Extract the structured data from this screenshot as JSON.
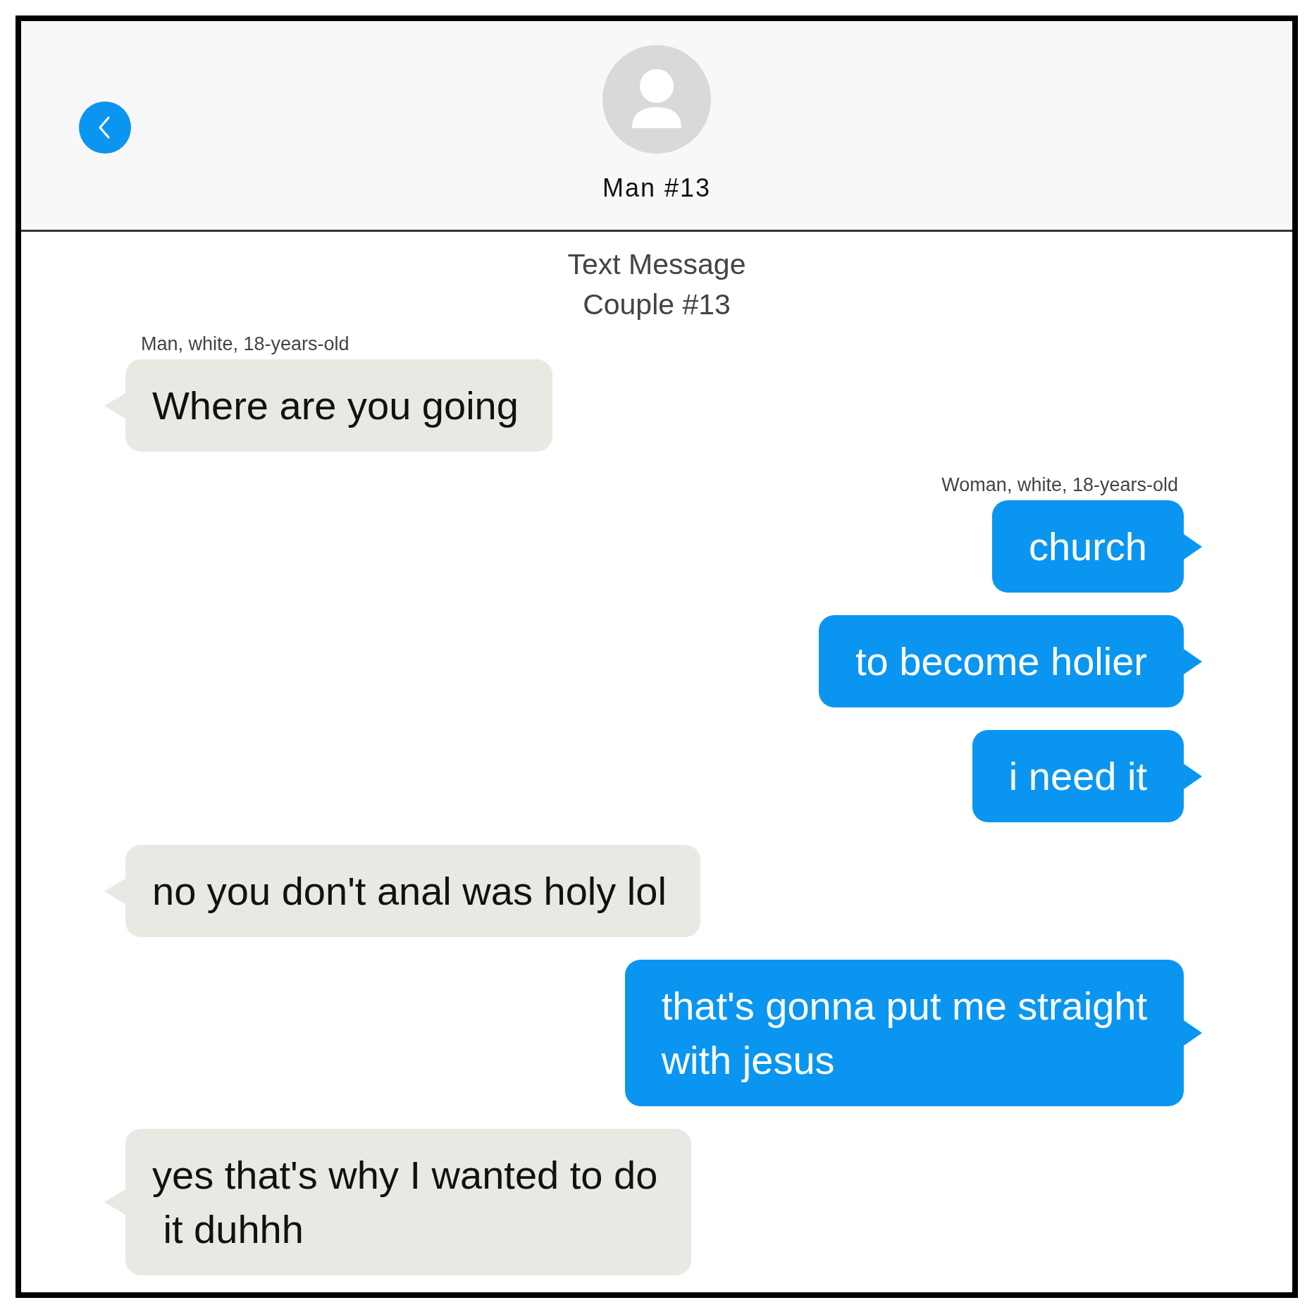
{
  "header": {
    "contact_name": "Man #13"
  },
  "conversation_title": [
    "Text Message",
    "Couple #13"
  ],
  "messages": [
    {
      "kind": "received",
      "sender": "Man, white, 18-years-old",
      "text": "Where are you going"
    },
    {
      "kind": "sent",
      "sender": "Woman, white, 18-years-old",
      "text": "church"
    },
    {
      "kind": "sent",
      "text": "to become holier"
    },
    {
      "kind": "sent",
      "text": "i need it"
    },
    {
      "kind": "received",
      "text": "no you don't anal was holy lol"
    },
    {
      "kind": "sent",
      "text": "that's gonna put me straight\nwith jesus"
    },
    {
      "kind": "received",
      "text": "yes that's why I wanted to do\n it duhhh"
    }
  ]
}
